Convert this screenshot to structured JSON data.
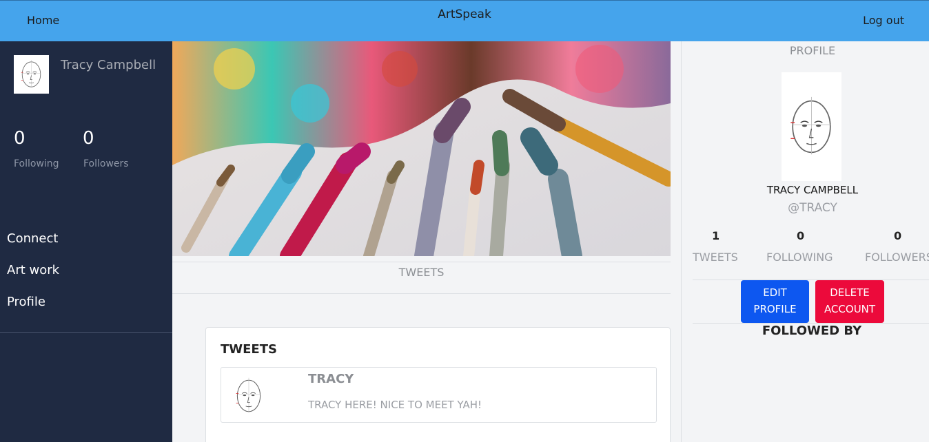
{
  "navbar": {
    "home": "Home",
    "title": "ArtSpeak",
    "logout": "Log out"
  },
  "sidebar": {
    "name": "Tracy Campbell",
    "following_count": "0",
    "following_label": "Following",
    "followers_count": "0",
    "followers_label": "Followers",
    "links": [
      "Connect",
      "Art work",
      "Profile"
    ]
  },
  "center": {
    "tab": "TWEETS",
    "tweets_heading": "TWEETS",
    "tweets": [
      {
        "user": "TRACY",
        "text": "TRACY HERE! NICE TO MEET YAH!"
      }
    ]
  },
  "profile": {
    "title": "PROFILE",
    "name": "TRACY CAMPBELL",
    "handle": "@TRACY",
    "stats": [
      {
        "value": "1",
        "label": "TWEETS"
      },
      {
        "value": "0",
        "label": "FOLLOWING"
      },
      {
        "value": "0",
        "label": "FOLLOWERS"
      }
    ],
    "edit_label": "EDIT PROFILE",
    "delete_label": "DELETE ACCOUNT",
    "followed_by": "FOLLOWED BY"
  },
  "colors": {
    "navbar": "#45a4ec",
    "sidebar": "#1f2a42",
    "edit": "#0d57f0",
    "delete": "#ec0a3b"
  }
}
